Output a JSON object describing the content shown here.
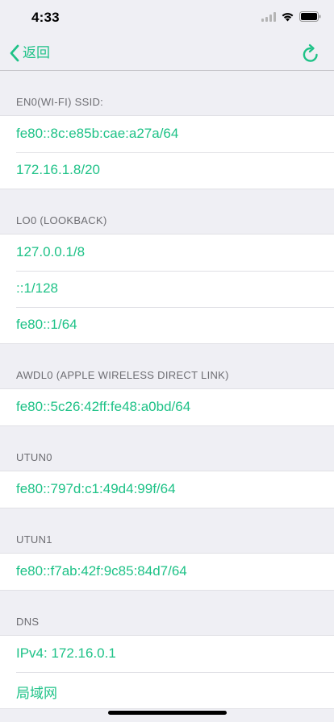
{
  "status_bar": {
    "time": "4:33"
  },
  "nav": {
    "back_label": "返回"
  },
  "colors": {
    "accent": "#1ec287",
    "background": "#efeff4",
    "header_text": "#6d6d72"
  },
  "sections": [
    {
      "header": "EN0(WI-FI) SSID:",
      "rows": [
        "fe80::8c:e85b:cae:a27a/64",
        "172.16.1.8/20"
      ]
    },
    {
      "header": "LO0 (LOOKBACK)",
      "rows": [
        "127.0.0.1/8",
        "::1/128",
        "fe80::1/64"
      ]
    },
    {
      "header": "AWDL0 (APPLE WIRELESS DIRECT LINK)",
      "rows": [
        "fe80::5c26:42ff:fe48:a0bd/64"
      ]
    },
    {
      "header": "UTUN0",
      "rows": [
        "fe80::797d:c1:49d4:99f/64"
      ]
    },
    {
      "header": "UTUN1",
      "rows": [
        "fe80::f7ab:42f:9c85:84d7/64"
      ]
    },
    {
      "header": "DNS",
      "rows": [
        "IPv4: 172.16.0.1",
        "局域网"
      ]
    }
  ]
}
